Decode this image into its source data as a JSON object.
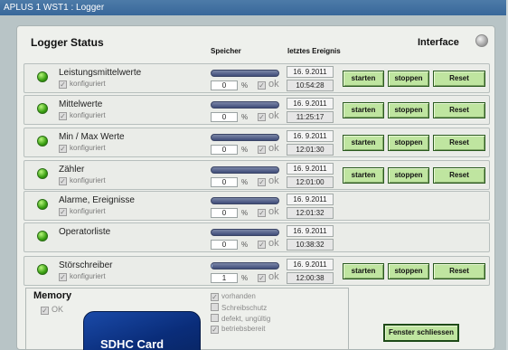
{
  "window": {
    "title": "APLUS 1 WST1 : Logger"
  },
  "header": {
    "title": "Logger Status",
    "speicher": "Speicher",
    "letztes_ereignis": "letztes Ereignis",
    "interface": "Interface"
  },
  "labels": {
    "konfiguriert": "konfiguriert",
    "percent": "%",
    "ok": "ok",
    "starten": "starten",
    "stoppen": "stoppen",
    "reset": "Reset"
  },
  "rows": [
    {
      "name": "Leistungsmittelwerte",
      "configured": true,
      "memory_percent": 0,
      "memory_display": "0",
      "date": "16. 9.2011",
      "time": "10:54:28",
      "has_controls": true
    },
    {
      "name": "Mittelwerte",
      "configured": true,
      "memory_percent": 0,
      "memory_display": "0",
      "date": "16. 9.2011",
      "time": "11:25:17",
      "has_controls": true
    },
    {
      "name": "Min / Max Werte",
      "configured": true,
      "memory_percent": 0,
      "memory_display": "0",
      "date": "16. 9.2011",
      "time": "12:01:30",
      "has_controls": true
    },
    {
      "name": "Zähler",
      "configured": true,
      "memory_percent": 0,
      "memory_display": "0",
      "date": "16. 9.2011",
      "time": "12:01:00",
      "has_controls": true
    },
    {
      "name": "Alarme, Ereignisse",
      "configured": true,
      "memory_percent": 0,
      "memory_display": "0",
      "date": "16. 9.2011",
      "time": "12:01:32",
      "has_controls": false
    },
    {
      "name": "Operatorliste",
      "configured": false,
      "memory_percent": 0,
      "memory_display": "0",
      "date": "16. 9.2011",
      "time": "10:38:32",
      "has_controls": false
    },
    {
      "name": "Störschreiber",
      "configured": true,
      "memory_percent": 1,
      "memory_display": "1",
      "date": "16. 9.2011",
      "time": "12:00:38",
      "has_controls": true
    }
  ],
  "memory": {
    "title": "Memory",
    "ok": "OK",
    "flags": [
      "vorhanden",
      "Schreibschutz",
      "defekt, ungültig",
      "betriebsbereit"
    ]
  },
  "sdcard": {
    "label": "SDHC Card"
  },
  "footer": {
    "close": "Fenster schliessen"
  },
  "colors": {
    "titlebar": "#38679a",
    "led_green": "#3aa012",
    "button_green": "#bfe5a0"
  }
}
